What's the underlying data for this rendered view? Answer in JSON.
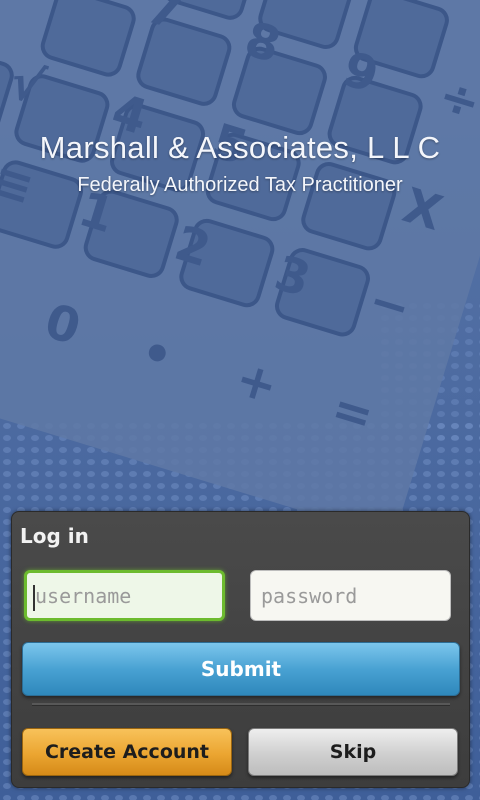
{
  "header": {
    "title": "Marshall & Associates, L L C",
    "subtitle": "Federally Authorized Tax Practitioner"
  },
  "background": {
    "keys": [
      "7",
      "8",
      "9",
      "√",
      "4",
      "5",
      "÷",
      "1",
      "2",
      "3",
      "X",
      "0",
      "•",
      "+",
      "=",
      "−",
      "≡"
    ]
  },
  "login": {
    "title": "Log in",
    "username": {
      "value": "",
      "placeholder": "username"
    },
    "password": {
      "value": "",
      "placeholder": "password"
    },
    "submit_label": "Submit",
    "create_account_label": "Create Account",
    "skip_label": "Skip"
  },
  "colors": {
    "background": "#4d6a9c",
    "panel": "#434343",
    "submit": "#49a2d3",
    "create_account": "#eba531",
    "skip": "#cfcfcf",
    "focus": "#6cbb2e"
  }
}
